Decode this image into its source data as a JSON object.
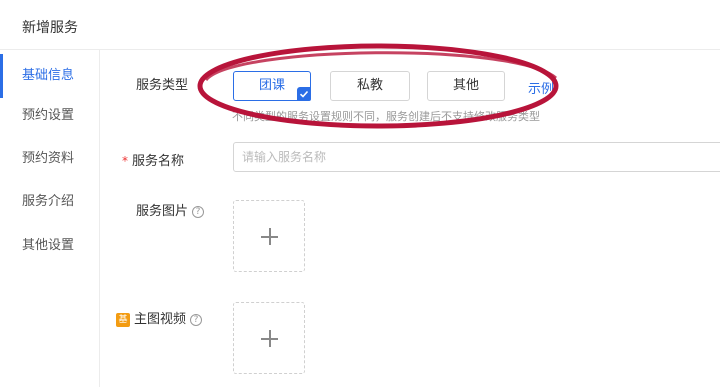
{
  "header": {
    "title": "新增服务"
  },
  "sidebar": {
    "items": [
      {
        "label": "基础信息",
        "active": true
      },
      {
        "label": "预约设置",
        "active": false
      },
      {
        "label": "预约资料",
        "active": false
      },
      {
        "label": "服务介绍",
        "active": false
      },
      {
        "label": "其他设置",
        "active": false
      }
    ]
  },
  "form": {
    "service_type": {
      "label": "服务类型",
      "options": [
        "团课",
        "私教",
        "其他"
      ],
      "selected": "团课",
      "example_link": "示例",
      "hint": "不同类型的服务设置规则不同，服务创建后不支持修改服务类型"
    },
    "service_name": {
      "required_mark": "*",
      "label": "服务名称",
      "placeholder": "请输入服务名称"
    },
    "service_image": {
      "label": "服务图片"
    },
    "main_video": {
      "badge": "基",
      "label": "主图视频"
    },
    "help_glyph": "?"
  },
  "colors": {
    "accent": "#2b6ee6",
    "annotation": "#b8143a",
    "required": "#e33333",
    "badge": "#f39c12"
  },
  "icons": [
    "check-icon",
    "plus-icon",
    "help-icon"
  ]
}
